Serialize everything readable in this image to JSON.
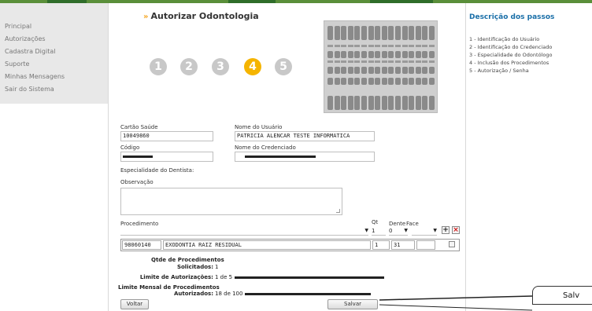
{
  "sidebar": {
    "items": [
      {
        "label": "Principal"
      },
      {
        "label": "Autorizações"
      },
      {
        "label": "Cadastra Digital"
      },
      {
        "label": "Suporte"
      },
      {
        "label": "Minhas Mensagens"
      },
      {
        "label": "Sair do Sistema"
      }
    ]
  },
  "page": {
    "title": "Autorizar Odontologia"
  },
  "steps": {
    "items": [
      "1",
      "2",
      "3",
      "4",
      "5"
    ],
    "active_label": "4",
    "active_color": "#f5b400",
    "inactive_color": "#c8c8c8"
  },
  "form": {
    "cartao_label": "Cartão Saúde",
    "cartao_value": "10049860",
    "usuario_label": "Nome do Usuário",
    "usuario_value": "PATRICIA ALENCAR TESTE INFORMATICA",
    "codigo_label": "Código",
    "credenciado_label": "Nome do Credenciado",
    "especialidade_label": "Especialidade do Dentista:",
    "observacao_label": "Observação",
    "procedimento_label": "Procedimento",
    "qt_label": "Qt",
    "dente_label": "Dente",
    "face_label": "Face",
    "qt_value": "1",
    "dente_value": "0",
    "add_label": "+",
    "remove_label": "×"
  },
  "procedures": {
    "rows": [
      {
        "code": "98060140",
        "desc": "EXODONTIA RAIZ RESIDUAL",
        "qt": "1",
        "dente": "31"
      }
    ]
  },
  "summary": {
    "title": "Qtde de Procedimentos",
    "solicitados_label": "Solicitados:",
    "solicitados_value": "1",
    "limite_label": "Limite de Autorizações:",
    "limite_value": "1 de 5",
    "mensal_title1": "Limite Mensal de Procedimentos",
    "autorizados_label": "Autorizados:",
    "autorizados_value": "18 de 100"
  },
  "buttons": {
    "voltar": "Voltar",
    "salvar": "Salvar"
  },
  "right_panel": {
    "title": "Descrição dos passos",
    "steps": [
      "1 - Identificação do Usuário",
      "2 - Identificação do Credenciado",
      "3 - Especialidade do Odontólogo",
      "4 - Inclusão dos Procedimentos",
      "5 - Autorização / Senha"
    ]
  },
  "callout": {
    "text": "Salv"
  },
  "colors": {
    "accent": "#f5b400",
    "brand": "#1a6fa8",
    "topbar": "#5a8f3a"
  }
}
